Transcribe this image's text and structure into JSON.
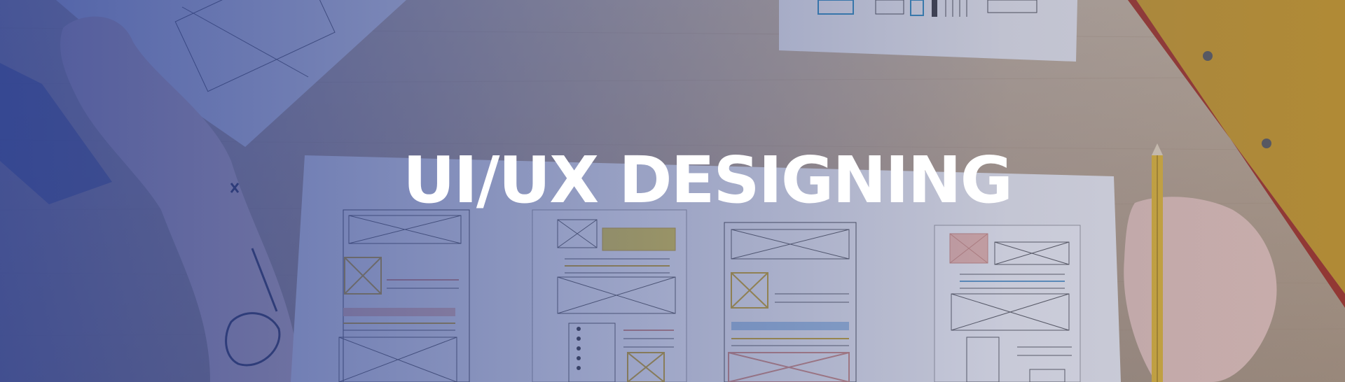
{
  "hero": {
    "title": "UI/UX DESIGNING"
  },
  "colors": {
    "overlay": "#2f4596",
    "title": "#ffffff",
    "desk": "#b7a58c"
  },
  "icons": [
    "wireframe-sketch",
    "pencil",
    "hand"
  ]
}
